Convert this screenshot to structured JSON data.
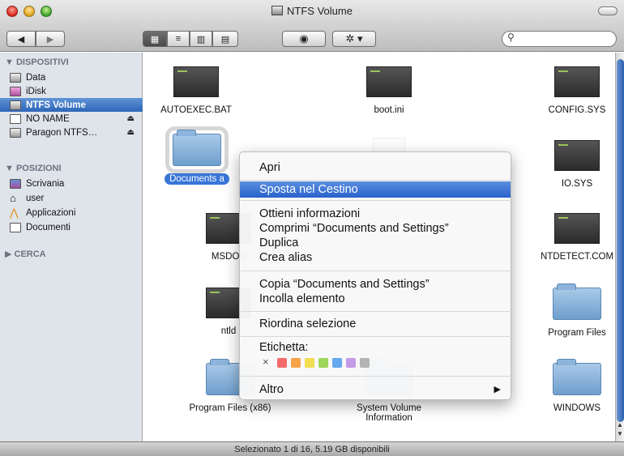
{
  "window": {
    "title": "NTFS Volume"
  },
  "toolbar": {
    "back_icon": "chevron-left-icon",
    "forward_icon": "chevron-right-icon",
    "view_icons": [
      "icon-view-icon",
      "list-view-icon",
      "column-view-icon",
      "coverflow-view-icon"
    ],
    "quicklook_icon": "eye-icon",
    "action_icon": "gear-icon",
    "search_placeholder": ""
  },
  "sidebar": {
    "devices_header": "▼ DISPOSITIVI",
    "devices": [
      {
        "label": "Data"
      },
      {
        "label": "iDisk"
      },
      {
        "label": "NTFS Volume",
        "selected": true
      },
      {
        "label": "NO NAME"
      },
      {
        "label": "Paragon NTFS…"
      }
    ],
    "places_header": "▼ POSIZIONI",
    "places": [
      {
        "label": "Scrivania"
      },
      {
        "label": "user"
      },
      {
        "label": "Applicazioni"
      },
      {
        "label": "Documenti"
      }
    ],
    "search_header": "▶ CERCA"
  },
  "files": [
    {
      "name": "AUTOEXEC.BAT",
      "kind": "exe"
    },
    {
      "name": "boot.ini",
      "kind": "exe"
    },
    {
      "name": "CONFIG.SYS",
      "kind": "exe"
    },
    {
      "name": "Documents and Settings",
      "shown_label": "Documents a",
      "kind": "folder",
      "selected": true
    },
    {
      "name": "IO.SYS",
      "kind": "exe"
    },
    {
      "name": "MSDOS",
      "kind": "exe"
    },
    {
      "name": "NTDETECT.COM",
      "kind": "exe"
    },
    {
      "name": "ntld",
      "kind": "exe"
    },
    {
      "name": "Program Files",
      "kind": "folder"
    },
    {
      "name": "Program Files (x86)",
      "kind": "folder"
    },
    {
      "name": "System Volume Information",
      "kind": "folder"
    },
    {
      "name": "WINDOWS",
      "kind": "folder"
    }
  ],
  "context_menu": {
    "items": {
      "open": "Apri",
      "trash": "Sposta nel Cestino",
      "info": "Ottieni informazioni",
      "compress": "Comprimi “Documents and Settings”",
      "duplicate": "Duplica",
      "alias": "Crea alias",
      "copy": "Copia “Documents and Settings”",
      "paste": "Incolla elemento",
      "arrange": "Riordina selezione",
      "label": "Etichetta:",
      "more": "Altro"
    },
    "label_none": "×",
    "label_colors": [
      "#f36b6b",
      "#f6a34a",
      "#f2dc4f",
      "#9ed55b",
      "#64a7ef",
      "#c49be7",
      "#b3b3b3"
    ]
  },
  "status": "Selezionato 1 di 16, 5.19 GB disponibili"
}
